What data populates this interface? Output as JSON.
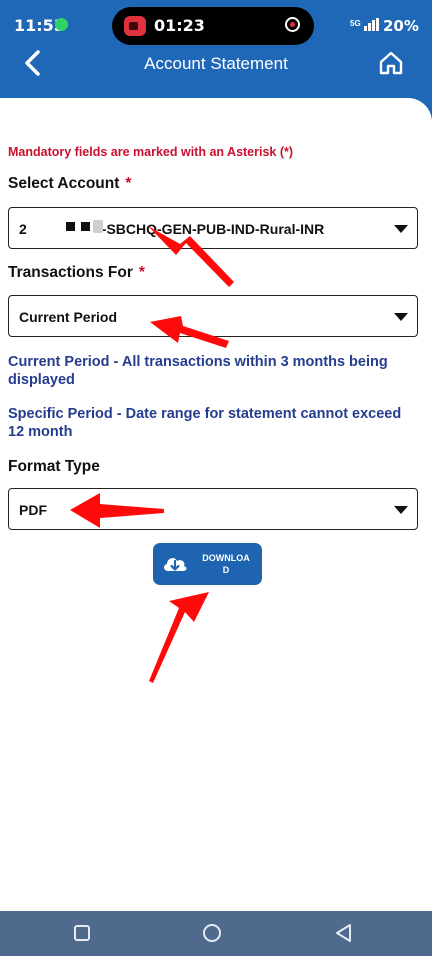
{
  "status_bar": {
    "time": "11:55",
    "recording_time": "01:23",
    "network": "5G",
    "battery": "20%"
  },
  "header": {
    "title": "Account Statement"
  },
  "form": {
    "mandatory_note": "Mandatory fields are marked with an Asterisk (*)",
    "required_mark": "*",
    "account": {
      "label": "Select Account",
      "value_prefix": "2",
      "value_suffix": "-SBCHQ-GEN-PUB-IND-Rural-INR"
    },
    "transactions": {
      "label": "Transactions For",
      "value": "Current Period"
    },
    "info_current": "Current Period - All transactions within 3 months being displayed",
    "info_specific": "Specific Period - Date range for statement cannot exceed 12 month",
    "format": {
      "label": "Format Type",
      "value": "PDF"
    },
    "download_button": {
      "label_line1": "DOWNLOA",
      "label_line2": "D"
    }
  },
  "colors": {
    "header_blue": "#1f68b8",
    "required_red": "#c8102e",
    "info_blue": "#263d8f",
    "button_blue": "#1f64b0",
    "annotation_red": "#ff0a0a",
    "navbar": "#4f6a8c"
  },
  "icons": {
    "back": "chevron-left-icon",
    "home": "home-icon",
    "download": "cloud-download-icon",
    "nav_recents": "square-icon",
    "nav_home": "circle-icon",
    "nav_back": "triangle-back-icon"
  }
}
